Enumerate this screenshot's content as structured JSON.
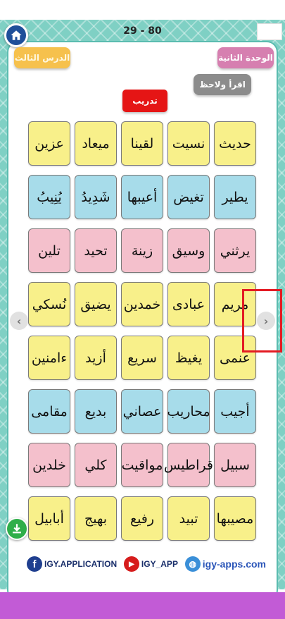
{
  "header": {
    "page_counter": "29 - 80",
    "home_icon": "home-icon"
  },
  "labels": {
    "lesson": "الدرس الثالث",
    "unit": "الوحدة الثانية",
    "read": "اقرأ ولاحظ",
    "train": "تدريب"
  },
  "grid_rows": [
    [
      {
        "word": "عزين",
        "color": "yellow"
      },
      {
        "word": "ميعاد",
        "color": "yellow"
      },
      {
        "word": "لقينا",
        "color": "yellow"
      },
      {
        "word": "نسيت",
        "color": "yellow"
      },
      {
        "word": "حديث",
        "color": "yellow"
      }
    ],
    [
      {
        "word": "يُنِيبُ",
        "color": "blue"
      },
      {
        "word": "شَدِيدُ",
        "color": "blue"
      },
      {
        "word": "أعيبها",
        "color": "blue"
      },
      {
        "word": "تغيض",
        "color": "blue"
      },
      {
        "word": "يطير",
        "color": "blue"
      }
    ],
    [
      {
        "word": "تلين",
        "color": "pink"
      },
      {
        "word": "تحيد",
        "color": "pink"
      },
      {
        "word": "زينة",
        "color": "pink"
      },
      {
        "word": "وسيق",
        "color": "pink"
      },
      {
        "word": "يرثني",
        "color": "pink"
      }
    ],
    [
      {
        "word": "نُسكي",
        "color": "yellow"
      },
      {
        "word": "يضيق",
        "color": "yellow"
      },
      {
        "word": "خمدين",
        "color": "yellow"
      },
      {
        "word": "عبادى",
        "color": "yellow"
      },
      {
        "word": "مريم",
        "color": "yellow"
      }
    ],
    [
      {
        "word": "ءامنين",
        "color": "yellow"
      },
      {
        "word": "أزيد",
        "color": "yellow"
      },
      {
        "word": "سريع",
        "color": "yellow"
      },
      {
        "word": "يغيظ",
        "color": "yellow"
      },
      {
        "word": "عنمى",
        "color": "yellow"
      }
    ],
    [
      {
        "word": "مقامى",
        "color": "blue"
      },
      {
        "word": "بديع",
        "color": "blue"
      },
      {
        "word": "عصاني",
        "color": "blue"
      },
      {
        "word": "محاريب",
        "color": "blue"
      },
      {
        "word": "أجيب",
        "color": "blue"
      }
    ],
    [
      {
        "word": "خلدين",
        "color": "pink"
      },
      {
        "word": "كلي",
        "color": "pink"
      },
      {
        "word": "مواقيت",
        "color": "pink"
      },
      {
        "word": "قراطيس",
        "color": "pink"
      },
      {
        "word": "سبيل",
        "color": "pink"
      }
    ],
    [
      {
        "word": "أبابيل",
        "color": "yellow"
      },
      {
        "word": "بهيج",
        "color": "yellow"
      },
      {
        "word": "رفيع",
        "color": "yellow"
      },
      {
        "word": "تبيد",
        "color": "yellow"
      },
      {
        "word": "مصيبها",
        "color": "yellow"
      }
    ]
  ],
  "footer": {
    "facebook": "IGY.APPLICATION",
    "youtube": "IGY_APP",
    "website": "igy-apps.com"
  },
  "icons": {
    "download": "download-icon",
    "nav_prev": "chevron-left-icon",
    "nav_next": "chevron-right-icon"
  },
  "colors": {
    "frame": "#7fd0c4",
    "yellow_card": "#f8f08a",
    "blue_card": "#a7dcea",
    "pink_card": "#f4c0cc",
    "train_button": "#e51515",
    "highlight": "#e31b23",
    "bottom_bar": "#c25bd6"
  }
}
